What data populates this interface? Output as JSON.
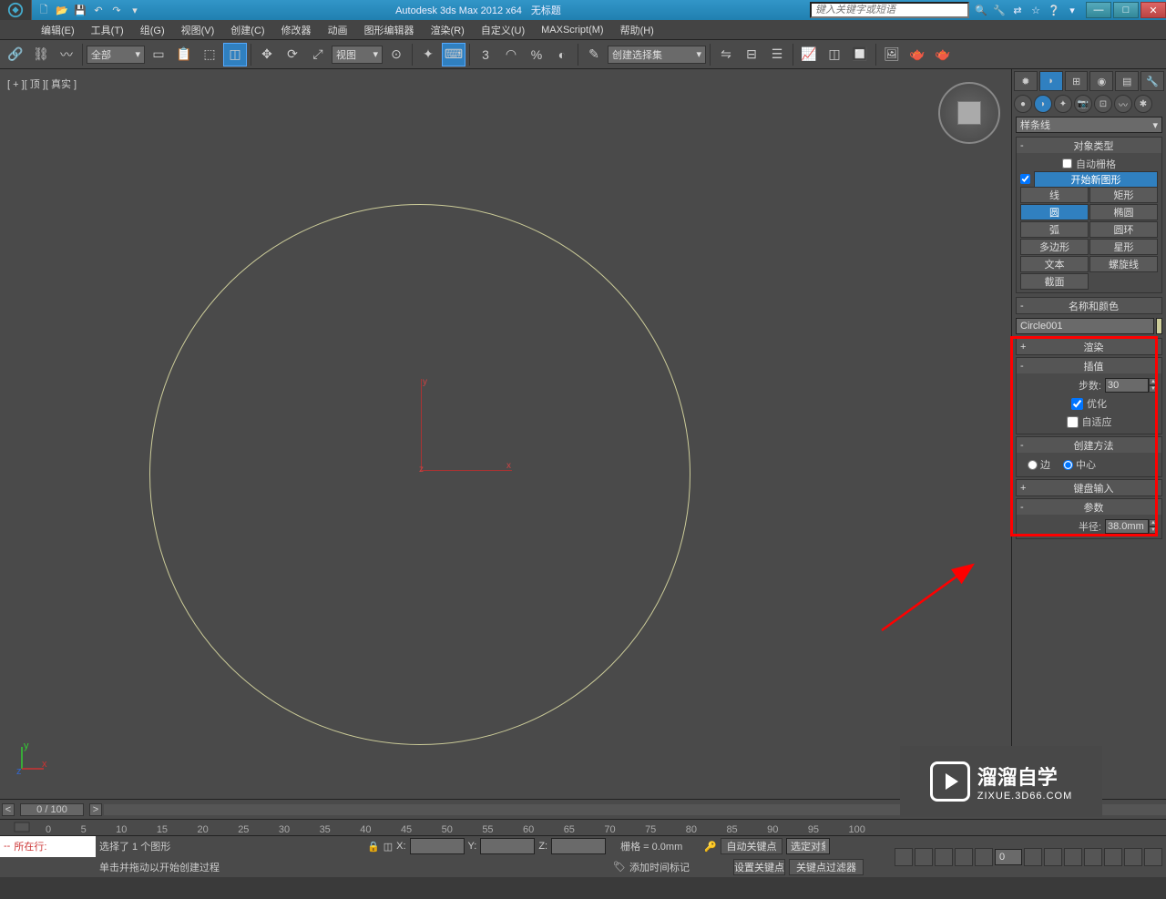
{
  "titlebar": {
    "app_title": "Autodesk 3ds Max  2012 x64",
    "doc_title": "无标题",
    "search_placeholder": "键入关键字或短语",
    "min": "—",
    "max": "□",
    "close": "✕"
  },
  "menubar": {
    "items": [
      "编辑(E)",
      "工具(T)",
      "组(G)",
      "视图(V)",
      "创建(C)",
      "修改器",
      "动画",
      "图形编辑器",
      "渲染(R)",
      "自定义(U)",
      "MAXScript(M)",
      "帮助(H)"
    ]
  },
  "toolbar": {
    "filter_combo": "全部",
    "view_combo": "视图",
    "selset_combo": "创建选择集"
  },
  "viewport": {
    "label": "[ + ][ 顶 ][ 真实 ]",
    "axis": {
      "x": "x",
      "y": "y",
      "z": "z"
    }
  },
  "cmdpanel": {
    "dropdown": "样条线",
    "rollouts": {
      "object_type": {
        "title": "对象类型",
        "auto_grid": "自动栅格",
        "start_new": "开始新图形",
        "buttons": [
          [
            "线",
            "矩形"
          ],
          [
            "圆",
            "椭圆"
          ],
          [
            "弧",
            "圆环"
          ],
          [
            "多边形",
            "星形"
          ],
          [
            "文本",
            "螺旋线"
          ],
          [
            "截面",
            ""
          ]
        ],
        "active": "圆"
      },
      "name_color": {
        "title": "名称和颜色",
        "name": "Circle001"
      },
      "rendering": {
        "title": "渲染"
      },
      "interpolation": {
        "title": "插值",
        "steps_label": "步数:",
        "steps_value": "30",
        "optimize": "优化",
        "adaptive": "自适应"
      },
      "creation_method": {
        "title": "创建方法",
        "edge": "边",
        "center": "中心"
      },
      "keyboard_entry": {
        "title": "键盘输入"
      },
      "parameters": {
        "title": "参数",
        "radius_label": "半径:",
        "radius_value": "38.0mm"
      }
    }
  },
  "timeline": {
    "frame": "0 / 100",
    "ticks": [
      "0",
      "5",
      "10",
      "15",
      "20",
      "25",
      "30",
      "35",
      "40",
      "45",
      "50",
      "55",
      "60",
      "65",
      "70",
      "75",
      "80",
      "85",
      "90",
      "95",
      "100"
    ]
  },
  "status": {
    "selection": "选择了 1 个图形",
    "prompt": "单击并拖动以开始创建过程",
    "locate": "所在行:",
    "x_label": "X:",
    "y_label": "Y:",
    "z_label": "Z:",
    "grid": "栅格 = 0.0mm",
    "add_time_tag": "添加时间标记",
    "auto_key": "自动关键点",
    "set_key": "设置关键点",
    "sel_obj": "选定对象",
    "key_filter": "关键点过滤器",
    "frame_num": "0"
  },
  "watermark": {
    "name": "溜溜自学",
    "url": "ZIXUE.3D66.COM"
  }
}
